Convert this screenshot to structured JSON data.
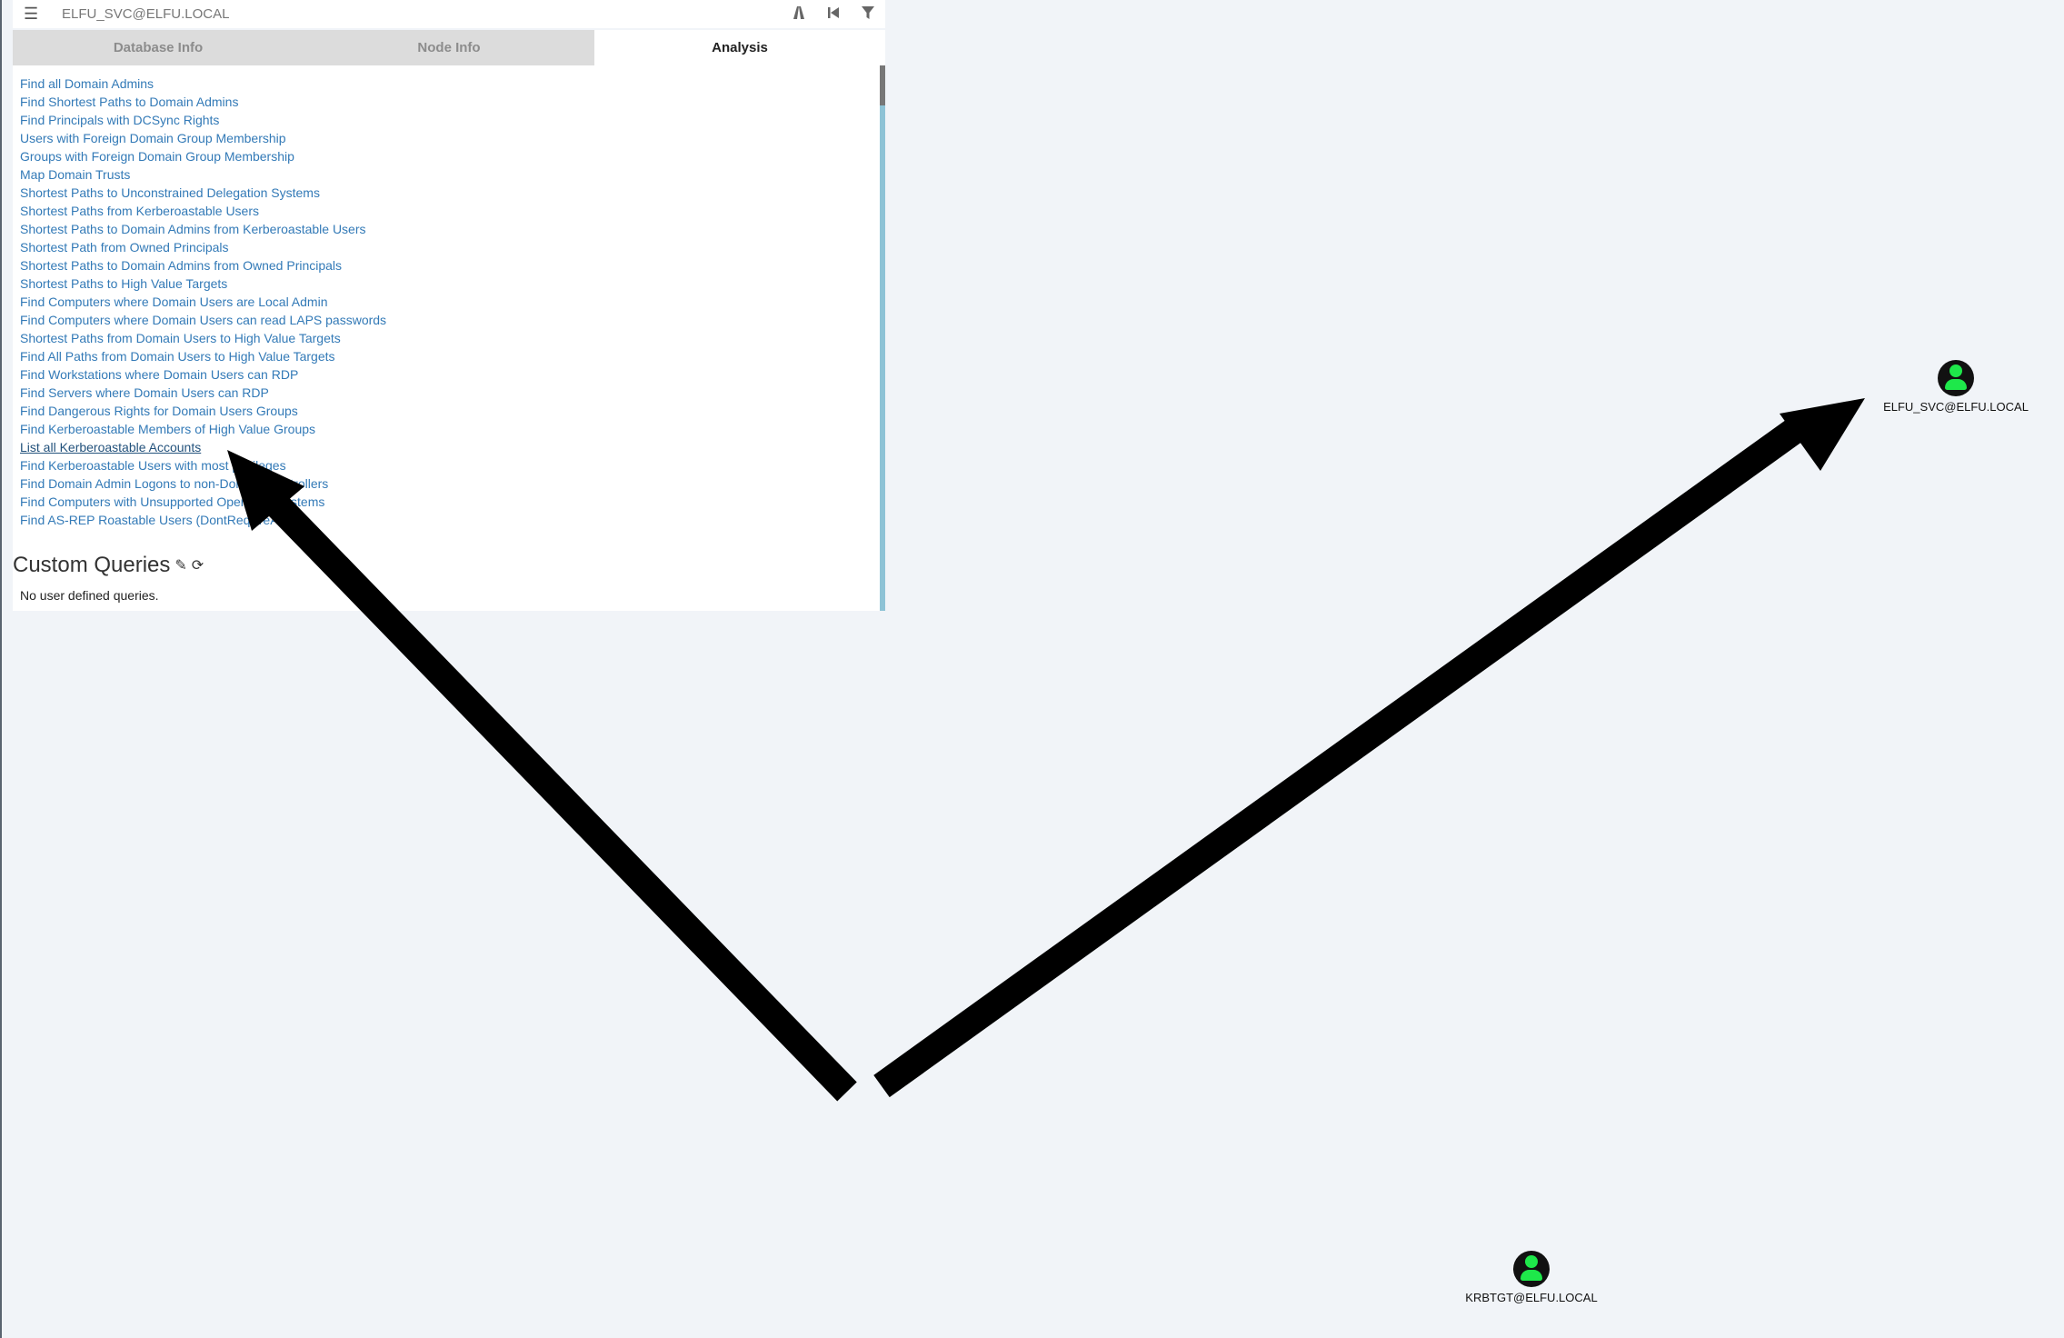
{
  "search": {
    "value": "ELFU_SVC@ELFU.LOCAL"
  },
  "toolbar": {
    "menu_icon": "hamburger-menu-icon",
    "icons": [
      "pathfinding-icon",
      "back-icon",
      "filter-icon"
    ]
  },
  "tabs": [
    {
      "label": "Database Info"
    },
    {
      "label": "Node Info"
    },
    {
      "label": "Analysis"
    }
  ],
  "queries": [
    "Find all Domain Admins",
    "Find Shortest Paths to Domain Admins",
    "Find Principals with DCSync Rights",
    "Users with Foreign Domain Group Membership",
    "Groups with Foreign Domain Group Membership",
    "Map Domain Trusts",
    "Shortest Paths to Unconstrained Delegation Systems",
    "Shortest Paths from Kerberoastable Users",
    "Shortest Paths to Domain Admins from Kerberoastable Users",
    "Shortest Path from Owned Principals",
    "Shortest Paths to Domain Admins from Owned Principals",
    "Shortest Paths to High Value Targets",
    "Find Computers where Domain Users are Local Admin",
    "Find Computers where Domain Users can read LAPS passwords",
    "Shortest Paths from Domain Users to High Value Targets",
    "Find All Paths from Domain Users to High Value Targets",
    "Find Workstations where Domain Users can RDP",
    "Find Servers where Domain Users can RDP",
    "Find Dangerous Rights for Domain Users Groups",
    "Find Kerberoastable Members of High Value Groups",
    "List all Kerberoastable Accounts",
    "Find Kerberoastable Users with most privileges",
    "Find Domain Admin Logons to non-Domain Controllers",
    "Find Computers with Unsupported Operating Systems",
    "Find AS-REP Roastable Users (DontReqPreAuth)"
  ],
  "custom_queries": {
    "title": "Custom Queries",
    "empty_text": "No user defined queries."
  },
  "nodes": {
    "node1": {
      "label": "ELFU_SVC@ELFU.LOCAL"
    },
    "node2": {
      "label": "KRBTGT@ELFU.LOCAL"
    }
  },
  "colors": {
    "link": "#337ab7",
    "user_node": "#1ee84a",
    "scrollbar": "#8ec3d6"
  }
}
